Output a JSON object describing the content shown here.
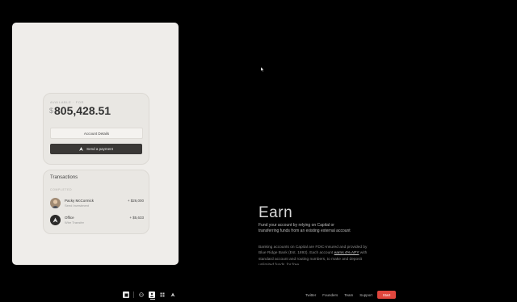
{
  "account": {
    "label": "AVAILABLE · FOR",
    "currency": "$",
    "balance": "805,428.51",
    "details_button": "Account Details",
    "send_button": "Send a payment"
  },
  "transactions": {
    "title": "Transactions",
    "section": "COMPLETED",
    "items": [
      {
        "name": "Packy McCormick",
        "sub": "Seed Investment",
        "amount": "+ $26,000"
      },
      {
        "name": "Office",
        "sub": "Wire Transfer",
        "amount": "+ $5,633"
      }
    ]
  },
  "hero": {
    "big": "Earn",
    "fund": "Fund your account by relying on Capital or transferring funds from an existing external account",
    "desc_pre": "Banking accounts on Capital are FDIC-insured and provided by Blue Ridge Bank (Est. 1893). Each account ",
    "desc_link": "earns 4% APY",
    "desc_post": " with standard account and routing numbers, to make and deposit unlimited funds, for free."
  },
  "bottom_bar": {
    "nav": [
      "Twitter",
      "Founders",
      "Team",
      "Support"
    ],
    "start": "Start"
  }
}
